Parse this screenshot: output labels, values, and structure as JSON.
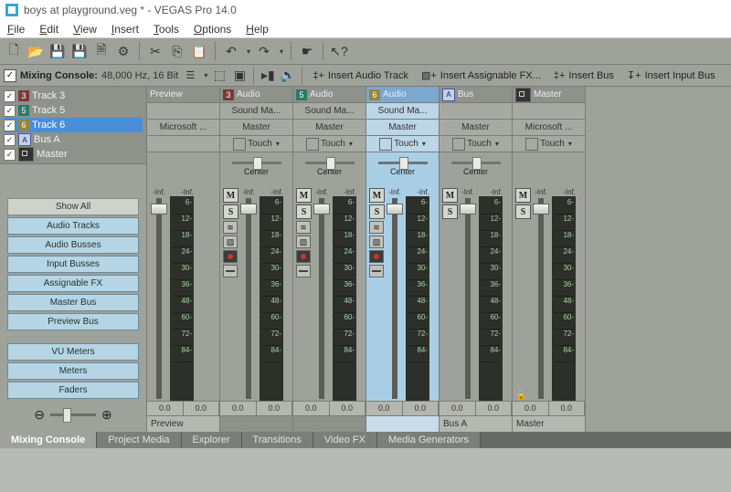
{
  "window": {
    "title": "boys at playground.veg * - VEGAS Pro 14.0"
  },
  "menu": [
    "File",
    "Edit",
    "View",
    "Insert",
    "Tools",
    "Options",
    "Help"
  ],
  "mixing_bar": {
    "checked": true,
    "label": "Mixing Console:",
    "info": "48,000 Hz, 16 Bit",
    "insert_audio": "Insert Audio Track",
    "insert_fx": "Insert Assignable FX...",
    "insert_bus": "Insert Bus",
    "insert_input": "Insert Input Bus"
  },
  "track_list": [
    {
      "checked": true,
      "badge": "3",
      "color": "br",
      "label": "Track 3",
      "sel": false
    },
    {
      "checked": true,
      "badge": "5",
      "color": "te",
      "label": "Track 5",
      "sel": false
    },
    {
      "checked": true,
      "badge": "6",
      "color": "yl",
      "label": "Track 6",
      "sel": true
    },
    {
      "checked": true,
      "badge": "A",
      "color": "bu",
      "label": "Bus A",
      "sel": false
    },
    {
      "checked": true,
      "badge": "",
      "color": "ms",
      "label": "Master",
      "sel": false
    }
  ],
  "show_buttons": {
    "showall": "Show All",
    "audiotracks": "Audio Tracks",
    "audiobusses": "Audio Busses",
    "inputbusses": "Input Busses",
    "assignablefx": "Assignable FX",
    "masterbus": "Master Bus",
    "previewbus": "Preview Bus",
    "vumeters": "VU Meters",
    "meters": "Meters",
    "faders": "Faders"
  },
  "meter_ticks": [
    "6-",
    "12-",
    "18-",
    "24-",
    "30-",
    "36-",
    "48-",
    "60-",
    "72-",
    "84-"
  ],
  "channels": [
    {
      "id": "preview",
      "header_kind": "plain",
      "header": "Preview",
      "fx": "",
      "route": "Microsoft ...",
      "touch": "",
      "pan": "",
      "has_btns": false,
      "foot": "Preview",
      "sel": false,
      "v1": "0.0",
      "v2": "0.0"
    },
    {
      "id": "t3",
      "badge": "3",
      "color": "br",
      "header": "Audio",
      "fx": "Sound Ma...",
      "route": "Master",
      "touch": "Touch",
      "pan": "Center",
      "has_btns": true,
      "foot": "",
      "sel": false,
      "v1": "0.0",
      "v2": "0.0"
    },
    {
      "id": "t5",
      "badge": "5",
      "color": "te",
      "header": "Audio",
      "fx": "Sound Ma...",
      "route": "Master",
      "touch": "Touch",
      "pan": "Center",
      "has_btns": true,
      "foot": "",
      "sel": false,
      "v1": "0.0",
      "v2": "0.0"
    },
    {
      "id": "t6",
      "badge": "6",
      "color": "yl",
      "header": "Audio",
      "fx": "Sound Ma...",
      "route": "Master",
      "touch": "Touch",
      "pan": "Center",
      "has_btns": true,
      "foot": "",
      "sel": true,
      "v1": "0.0",
      "v2": "0.0"
    },
    {
      "id": "busA",
      "badge": "A",
      "color": "bu",
      "header": "Bus",
      "fx": "",
      "route": "Master",
      "touch": "Touch",
      "pan": "Center",
      "has_btns": true,
      "simple_btns": true,
      "foot": "Bus A",
      "sel": false,
      "v1": "0.0",
      "v2": "0.0"
    },
    {
      "id": "master",
      "badge": "",
      "color": "ms",
      "header": "Master",
      "fx": "",
      "route": "Microsoft ...",
      "touch": "Touch",
      "pan": "",
      "has_btns": true,
      "simple_btns": true,
      "lock": true,
      "foot": "Master",
      "sel": false,
      "v1": "0.0",
      "v2": "0.0"
    }
  ],
  "inf_label": "-Inf.",
  "tabs": [
    "Mixing Console",
    "Project Media",
    "Explorer",
    "Transitions",
    "Video FX",
    "Media Generators"
  ],
  "active_tab": "Mixing Console"
}
